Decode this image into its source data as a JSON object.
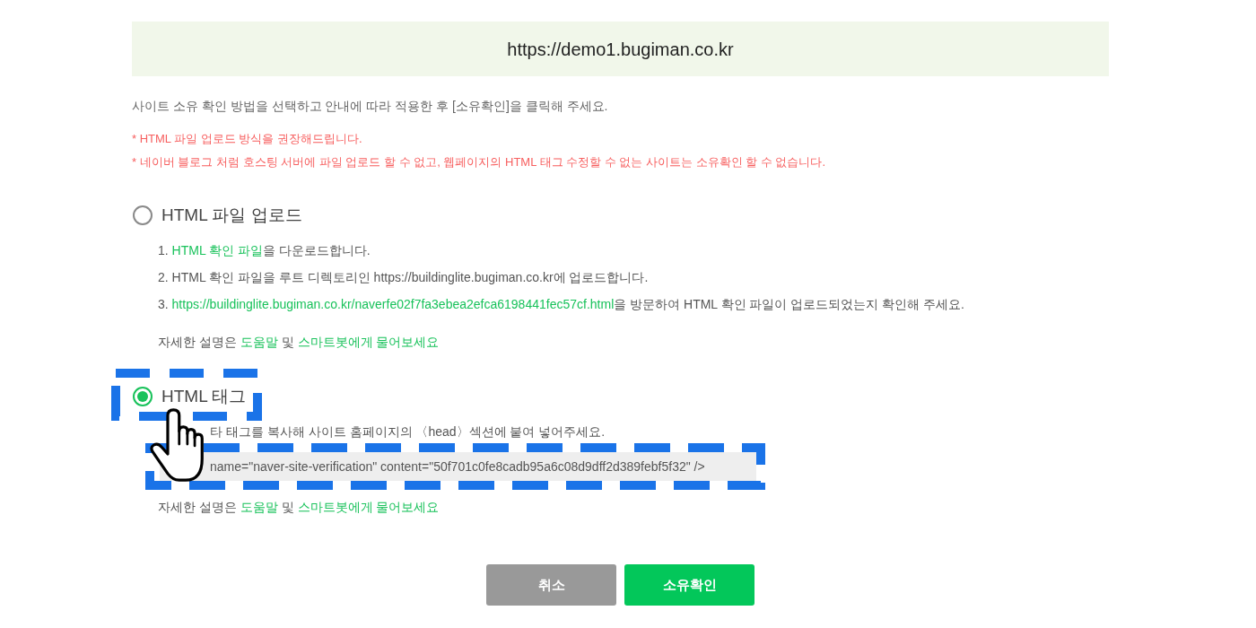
{
  "site_url": "https://demo1.bugiman.co.kr",
  "instruction": "사이트 소유 확인 방법을 선택하고 안내에 따라 적용한 후 [소유확인]을 클릭해 주세요.",
  "notices": [
    "* HTML 파일 업로드 방식을 권장해드립니다.",
    "* 네이버 블로그 처럼 호스팅 서버에 파일 업로드 할 수 없고, 웹페이지의 HTML 태그 수정할 수 없는 사이트는 소유확인 할 수 없습니다."
  ],
  "methods": [
    {
      "label": "HTML 파일 업로드",
      "selected": false,
      "highlighted": false,
      "steps": [
        [
          {
            "kind": "text",
            "text": "1. "
          },
          {
            "kind": "link",
            "text": "HTML 확인 파일"
          },
          {
            "kind": "text",
            "text": "을 다운로드합니다."
          }
        ],
        [
          {
            "kind": "text",
            "text": "2. HTML 확인 파일을 루트 디렉토리인 https://buildinglite.bugiman.co.kr에 업로드합니다."
          }
        ],
        [
          {
            "kind": "text",
            "text": "3. "
          },
          {
            "kind": "link",
            "text": "https://buildinglite.bugiman.co.kr/naverfe02f7fa3ebea2efca6198441fec57cf.html"
          },
          {
            "kind": "text",
            "text": "을 방문하여 HTML 확인 파일이 업로드되었는지 확인해 주세요."
          }
        ]
      ],
      "help": [
        {
          "kind": "text",
          "text": "자세한 설명은 "
        },
        {
          "kind": "link",
          "text": "도움말"
        },
        {
          "kind": "text",
          "text": " 및 "
        },
        {
          "kind": "link",
          "text": "스마트봇에게 물어보세요"
        }
      ]
    },
    {
      "label": "HTML 태그",
      "selected": true,
      "highlighted": true,
      "description": "타 태그를 복사해 사이트 홈페이지의 〈head〉섹션에 붙여 넣어주세요.",
      "code": "name=\"naver-site-verification\" content=\"50f701c0fe8cadb95a6c08d9dff2d389febf5f32\" />",
      "help": [
        {
          "kind": "text",
          "text": "자세한 설명은 "
        },
        {
          "kind": "link",
          "text": "도움말"
        },
        {
          "kind": "text",
          "text": " 및 "
        },
        {
          "kind": "link",
          "text": "스마트봇에게 물어보세요"
        }
      ]
    }
  ],
  "buttons": [
    {
      "label": "취소",
      "kind": "cancel"
    },
    {
      "label": "소유확인",
      "kind": "confirm"
    }
  ]
}
